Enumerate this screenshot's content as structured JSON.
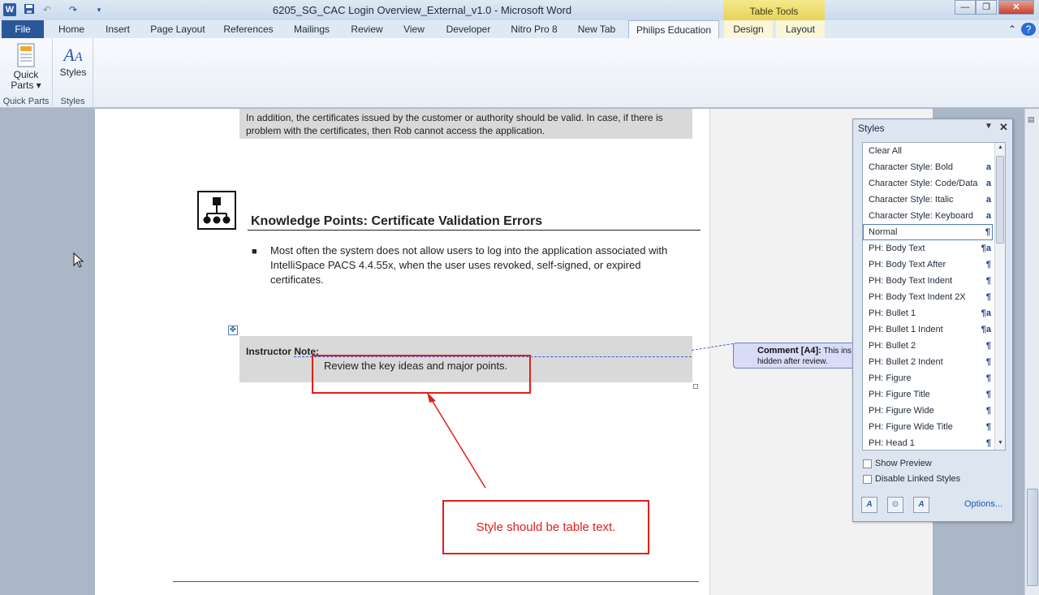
{
  "window": {
    "title": "6205_SG_CAC Login Overview_External_v1.0 - Microsoft Word",
    "app_icon": "W",
    "contextual_group": "Table Tools"
  },
  "tabs": [
    {
      "label": "File"
    },
    {
      "label": "Home"
    },
    {
      "label": "Insert"
    },
    {
      "label": "Page Layout"
    },
    {
      "label": "References"
    },
    {
      "label": "Mailings"
    },
    {
      "label": "Review"
    },
    {
      "label": "View"
    },
    {
      "label": "Developer"
    },
    {
      "label": "Nitro Pro 8"
    },
    {
      "label": "New Tab"
    },
    {
      "label": "Philips Education"
    },
    {
      "label": "Design"
    },
    {
      "label": "Layout"
    }
  ],
  "ribbon": {
    "quick_parts_label": "Quick",
    "quick_parts_label2": "Parts ▾",
    "styles_button_label": "Styles",
    "group1": "Quick Parts",
    "group2": "Styles"
  },
  "document": {
    "top_para_line1": "In addition, the certificates issued by the customer or authority should be valid. In case, if there is",
    "top_para_line2": "problem with the certificates, then Rob cannot access the application.",
    "heading": "Knowledge Points: Certificate Validation Errors",
    "bullet_line1": "Most often the system does not allow users to log into the application associated with",
    "bullet_line2": "IntelliSpace PACS 4.4.55x, when the user uses revoked, self-signed, or expired",
    "bullet_line3": "certificates.",
    "bullet_marker": "■",
    "instructor_note": "Instructor Note:",
    "review_text": "Review the key ideas and major points.",
    "annotation": "Style should be table text.",
    "comment_label": "Comment [A4]:",
    "comment_text": "This ins",
    "comment_text2": "hidden after review."
  },
  "styles_pane": {
    "title": "Styles",
    "items": [
      {
        "name": "Clear All",
        "mark": ""
      },
      {
        "name": "Character Style: Bold",
        "mark": "a"
      },
      {
        "name": "Character Style: Code/Data",
        "mark": "a"
      },
      {
        "name": "Character Style: Italic",
        "mark": "a"
      },
      {
        "name": "Character Style: Keyboard",
        "mark": "a"
      },
      {
        "name": "Normal",
        "mark": "¶"
      },
      {
        "name": "PH: Body Text",
        "mark": "¶a"
      },
      {
        "name": "PH: Body Text After",
        "mark": "¶"
      },
      {
        "name": "PH: Body Text Indent",
        "mark": "¶"
      },
      {
        "name": "PH: Body Text Indent 2X",
        "mark": "¶"
      },
      {
        "name": "PH: Bullet 1",
        "mark": "¶a"
      },
      {
        "name": "PH: Bullet 1 Indent",
        "mark": "¶a"
      },
      {
        "name": "PH: Bullet 2",
        "mark": "¶"
      },
      {
        "name": "PH: Bullet 2 Indent",
        "mark": "¶"
      },
      {
        "name": "PH: Figure",
        "mark": "¶"
      },
      {
        "name": "PH: Figure Title",
        "mark": "¶"
      },
      {
        "name": "PH: Figure Wide",
        "mark": "¶"
      },
      {
        "name": "PH: Figure Wide Title",
        "mark": "¶"
      },
      {
        "name": "PH: Head 1",
        "mark": "¶"
      }
    ],
    "show_preview": "Show Preview",
    "disable_linked": "Disable Linked Styles",
    "options": "Options..."
  },
  "colors": {
    "annotation_red": "#e0201b",
    "file_tab": "#2b5797",
    "table_tools": "#e6d35a"
  }
}
